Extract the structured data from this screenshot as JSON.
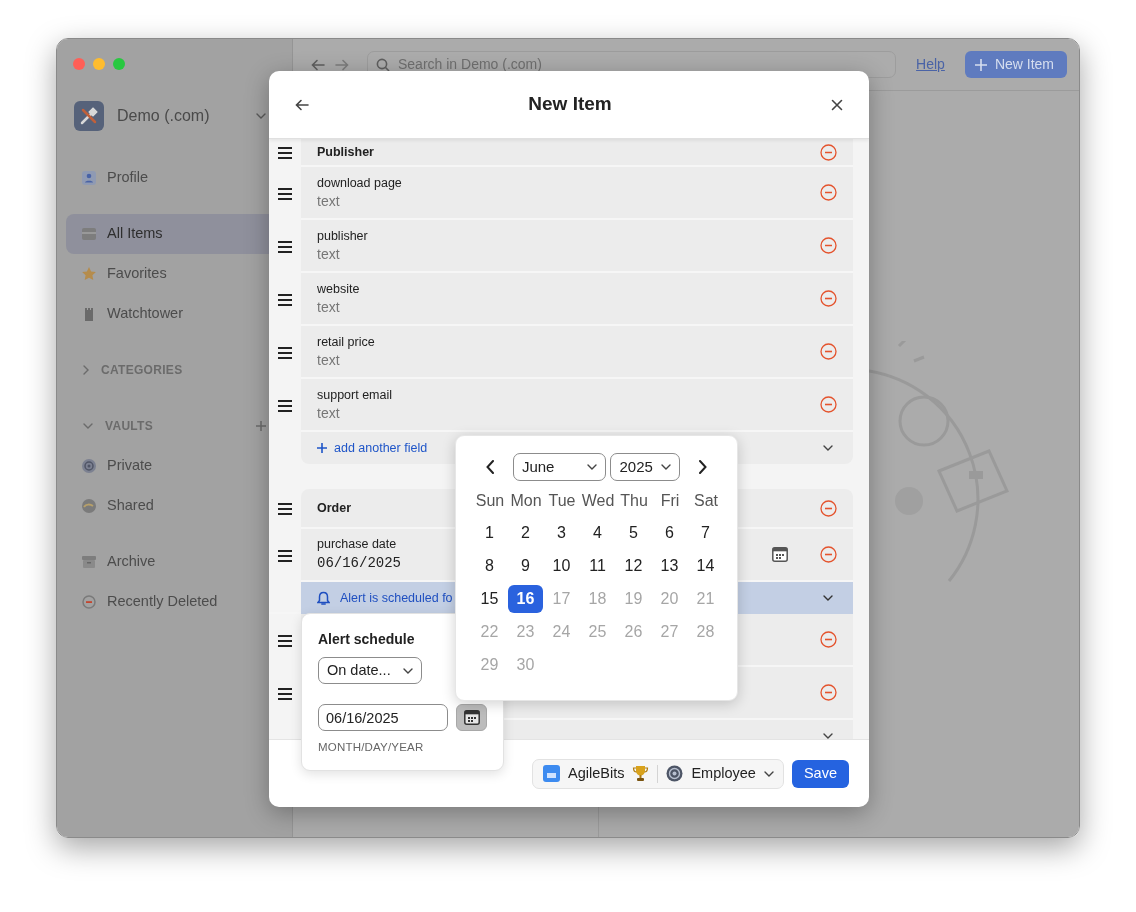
{
  "sidebar": {
    "account": "Demo (.com)",
    "groups": [
      {
        "items": [
          {
            "label": "Profile",
            "selected": false
          }
        ]
      },
      {
        "items": [
          {
            "label": "All Items",
            "selected": true
          },
          {
            "label": "Favorites",
            "selected": false
          },
          {
            "label": "Watchtower",
            "selected": false
          }
        ]
      },
      {
        "heading": "CATEGORIES",
        "expanded": false
      },
      {
        "heading": "VAULTS",
        "expanded": true,
        "items": [
          {
            "label": "Private",
            "selected": false
          },
          {
            "label": "Shared",
            "selected": false
          }
        ]
      },
      {
        "items": [
          {
            "label": "Archive",
            "selected": false
          },
          {
            "label": "Recently Deleted",
            "selected": false
          }
        ]
      }
    ]
  },
  "toolbar": {
    "search": {
      "placeholder": "Search in Demo (.com)"
    },
    "help": "Help",
    "new_item": "New Item"
  },
  "dialog": {
    "title": "New Item",
    "sections": [
      {
        "title": "Publisher",
        "fields": [
          {
            "kind": "text",
            "label": "download page",
            "placeholder": "text"
          },
          {
            "kind": "text",
            "label": "publisher",
            "placeholder": "text"
          },
          {
            "kind": "text",
            "label": "website",
            "placeholder": "text"
          },
          {
            "kind": "text",
            "label": "retail price",
            "placeholder": "text"
          },
          {
            "kind": "text",
            "label": "support email",
            "placeholder": "text"
          }
        ],
        "add_field": "add another field"
      },
      {
        "title": "Order",
        "fields": [
          {
            "kind": "date",
            "label": "purchase date",
            "value": "06/16/2025",
            "alert": "Alert is scheduled fo"
          },
          {
            "kind": "covered"
          },
          {
            "kind": "covered"
          }
        ]
      }
    ],
    "footer": {
      "vault": "AgileBits",
      "role": "Employee",
      "save": "Save"
    }
  },
  "date_picker": {
    "month": "June",
    "year": "2025",
    "weekdays": [
      "Sun",
      "Mon",
      "Tue",
      "Wed",
      "Thu",
      "Fri",
      "Sat"
    ],
    "days": [
      {
        "label": "1",
        "selected": false,
        "disabled": false
      },
      {
        "label": "2",
        "selected": false,
        "disabled": false
      },
      {
        "label": "3",
        "selected": false,
        "disabled": false
      },
      {
        "label": "4",
        "selected": false,
        "disabled": false
      },
      {
        "label": "5",
        "selected": false,
        "disabled": false
      },
      {
        "label": "6",
        "selected": false,
        "disabled": false
      },
      {
        "label": "7",
        "selected": false,
        "disabled": false
      },
      {
        "label": "8",
        "selected": false,
        "disabled": false
      },
      {
        "label": "9",
        "selected": false,
        "disabled": false
      },
      {
        "label": "10",
        "selected": false,
        "disabled": false
      },
      {
        "label": "11",
        "selected": false,
        "disabled": false
      },
      {
        "label": "12",
        "selected": false,
        "disabled": false
      },
      {
        "label": "13",
        "selected": false,
        "disabled": false
      },
      {
        "label": "14",
        "selected": false,
        "disabled": false
      },
      {
        "label": "15",
        "selected": false,
        "disabled": false
      },
      {
        "label": "16",
        "selected": true,
        "disabled": false
      },
      {
        "label": "17",
        "selected": false,
        "disabled": true
      },
      {
        "label": "18",
        "selected": false,
        "disabled": true
      },
      {
        "label": "19",
        "selected": false,
        "disabled": true
      },
      {
        "label": "20",
        "selected": false,
        "disabled": true
      },
      {
        "label": "21",
        "selected": false,
        "disabled": true
      },
      {
        "label": "22",
        "selected": false,
        "disabled": true
      },
      {
        "label": "23",
        "selected": false,
        "disabled": true
      },
      {
        "label": "24",
        "selected": false,
        "disabled": true
      },
      {
        "label": "25",
        "selected": false,
        "disabled": true
      },
      {
        "label": "26",
        "selected": false,
        "disabled": true
      },
      {
        "label": "27",
        "selected": false,
        "disabled": true
      },
      {
        "label": "28",
        "selected": false,
        "disabled": true
      },
      {
        "label": "29",
        "selected": false,
        "disabled": true
      },
      {
        "label": "30",
        "selected": false,
        "disabled": true
      }
    ]
  },
  "alert_schedule": {
    "title": "Alert schedule",
    "mode": "On date...",
    "date": "06/16/2025",
    "hint": "MONTH/DAY/YEAR"
  }
}
